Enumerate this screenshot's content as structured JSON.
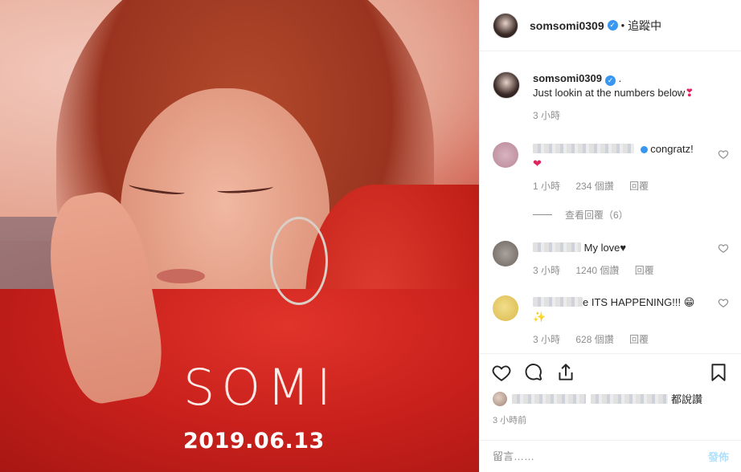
{
  "photo": {
    "brand_text": "SOMI",
    "date_text": "2019.06.13"
  },
  "header": {
    "username": "somsomi0309",
    "separator": "•",
    "follow_status": "追蹤中"
  },
  "caption": {
    "username": "somsomi0309",
    "suffix": ".",
    "text": "Just lookin at the numbers below",
    "emoji": "❣",
    "time": "3 小時"
  },
  "comments": [
    {
      "text": "congratz!",
      "emoji": "❤",
      "time": "1 小時",
      "likes": "234 個讚",
      "reply": "回覆",
      "view_replies": "查看回覆（6）",
      "avatar_color": "#c9a0ad"
    },
    {
      "text": "My love♥",
      "time": "3 小時",
      "likes": "1240 個讚",
      "reply": "回覆",
      "avatar_color": "#8a7f78"
    },
    {
      "text": "e ITS HAPPENING!!! 😁",
      "emoji2": "✨",
      "time": "3 小時",
      "likes": "628 個讚",
      "reply": "回覆",
      "avatar_color": "#e8cf6a"
    }
  ],
  "actions": {
    "like_icon": "heart-icon",
    "comment_icon": "comment-icon",
    "share_icon": "share-icon",
    "save_icon": "bookmark-icon"
  },
  "likes_line": {
    "suffix": "都說讚"
  },
  "timestamp": "3 小時前",
  "add_comment": {
    "placeholder": "留言……",
    "post_label": "發佈"
  },
  "colors": {
    "verified": "#3897f0",
    "muted": "#8e8e8e",
    "post_disabled": "#b2dffc"
  }
}
